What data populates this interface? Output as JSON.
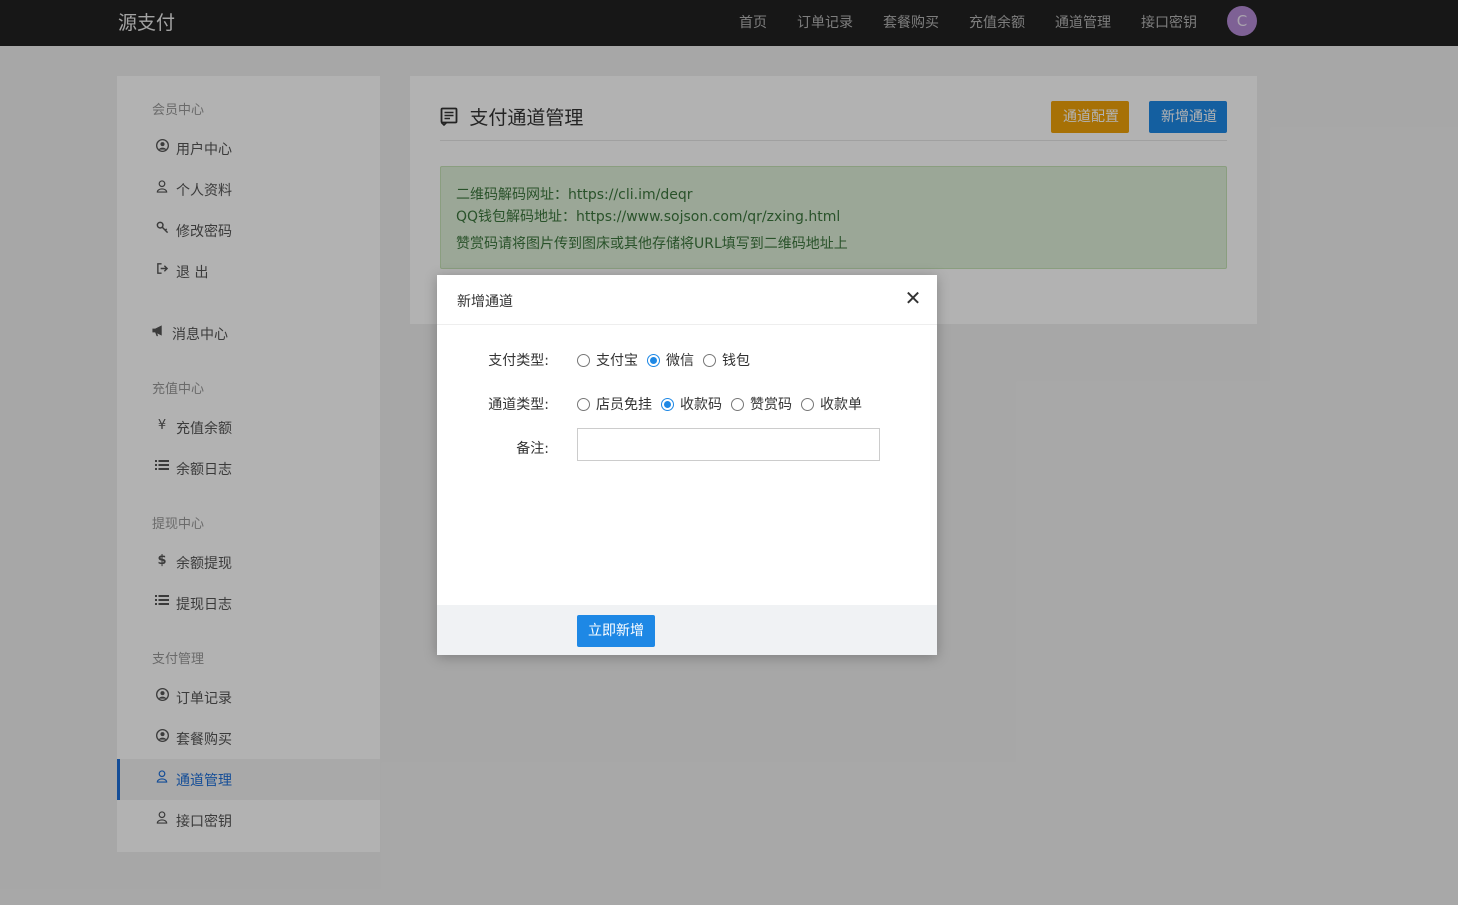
{
  "navbar": {
    "brand": "源支付",
    "links": [
      "首页",
      "订单记录",
      "套餐购买",
      "充值余额",
      "通道管理",
      "接口密钥"
    ],
    "avatar_letter": "C"
  },
  "sidebar": {
    "groups": [
      "会员中心",
      "充值中心",
      "提现中心",
      "支付管理"
    ],
    "items": [
      {
        "label": "用户中心",
        "icon": "user-circle-icon"
      },
      {
        "label": "个人资料",
        "icon": "user-icon"
      },
      {
        "label": "修改密码",
        "icon": "key-icon"
      },
      {
        "label": "退 出",
        "icon": "sign-out-icon"
      },
      {
        "label": "消息中心",
        "icon": "bullhorn-icon"
      },
      {
        "label": "充值余额",
        "icon": "yen-icon"
      },
      {
        "label": "余额日志",
        "icon": "list-icon"
      },
      {
        "label": "余额提现",
        "icon": "dollar-icon"
      },
      {
        "label": "提现日志",
        "icon": "list-icon"
      },
      {
        "label": "订单记录",
        "icon": "user-circle-icon"
      },
      {
        "label": "套餐购买",
        "icon": "user-circle-icon"
      },
      {
        "label": "通道管理",
        "icon": "user-icon"
      },
      {
        "label": "接口密钥",
        "icon": "user-icon"
      }
    ],
    "active_item": "通道管理"
  },
  "panel": {
    "title": "支付通道管理",
    "btn_config": "通道配置",
    "btn_add": "新增通道",
    "alert_lines": [
      "二维码解码网址：https://cli.im/deqr",
      "QQ钱包解码地址：https://www.sojson.com/qr/zxing.html",
      "赞赏码请将图片传到图床或其他存储将URL填写到二维码地址上"
    ]
  },
  "modal": {
    "title": "新增通道",
    "close_glyph": "✕",
    "pay_type_label": "支付类型:",
    "pay_type_options": [
      "支付宝",
      "微信",
      "钱包"
    ],
    "pay_type_selected": "微信",
    "channel_type_label": "通道类型:",
    "channel_type_options": [
      "店员免挂",
      "收款码",
      "赞赏码",
      "收款单"
    ],
    "channel_type_selected": "收款码",
    "remark_label": "备注:",
    "remark_value": "",
    "submit_label": "立即新增"
  },
  "colors": {
    "navbar_bg": "#222222",
    "primary": "#1e88e5",
    "warning": "#f0a30a",
    "alert_bg": "#dff0d8",
    "alert_text": "#3c763d",
    "avatar_bg": "#b58bd6"
  }
}
